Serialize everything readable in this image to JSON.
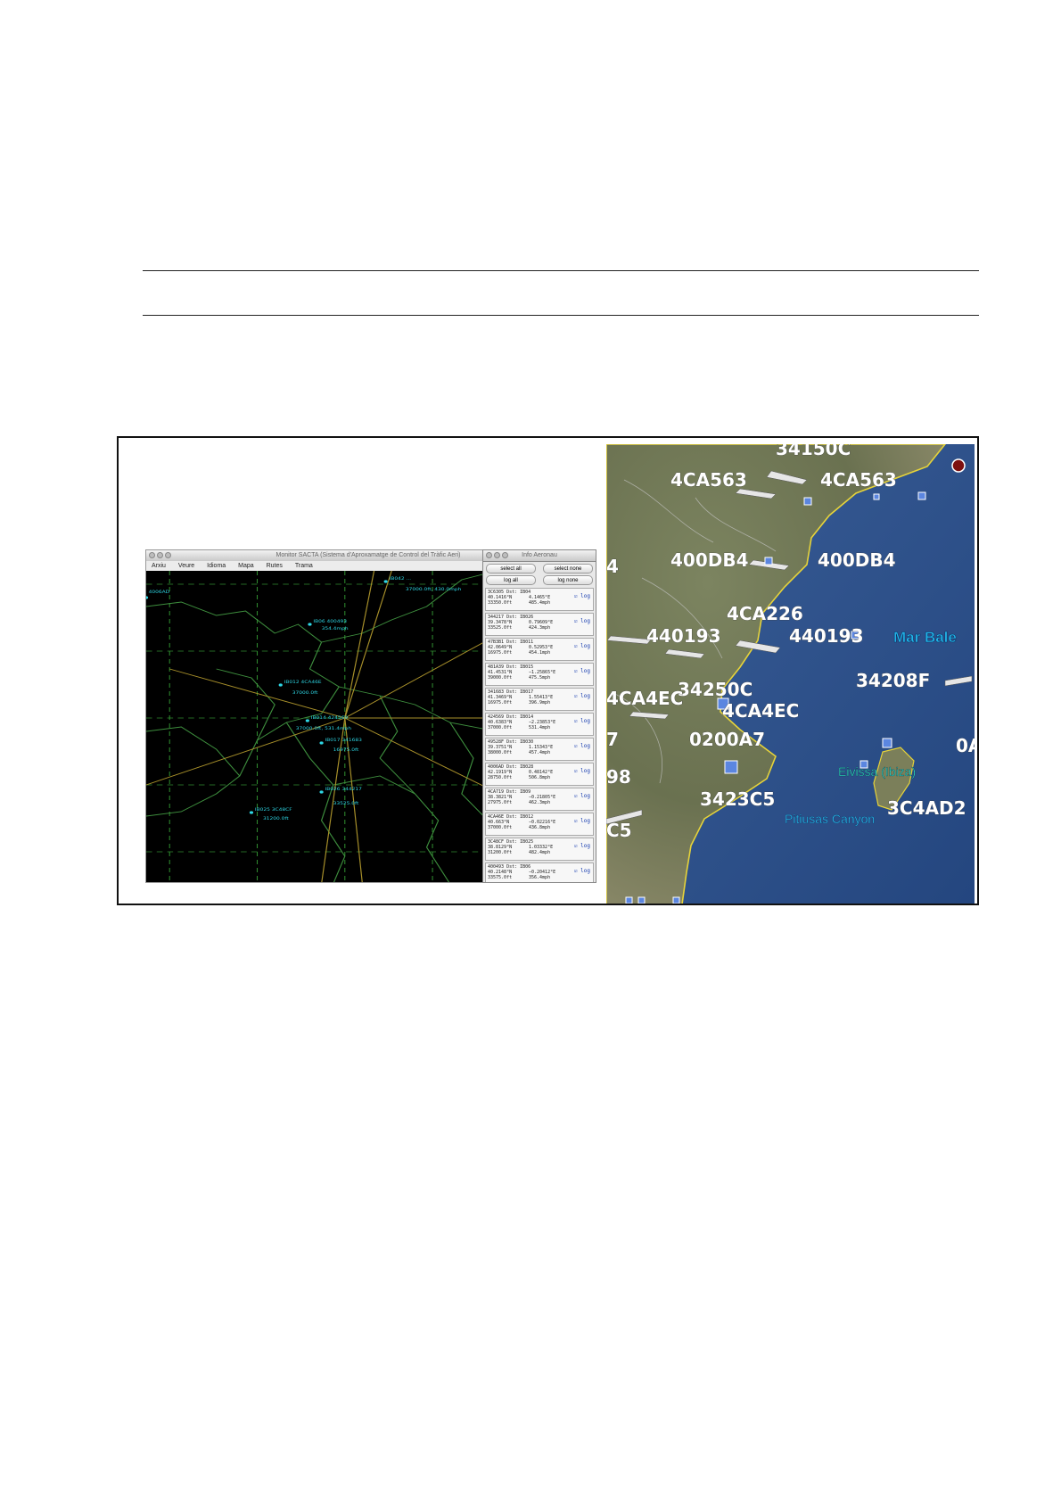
{
  "radar_window": {
    "title": "Monitor SACTA (Sistema d'Aproxamatge de Control del Tràfic Aeri)",
    "menu": [
      "Arxiu",
      "Veure",
      "Idioma",
      "Mapa",
      "Rutes",
      "Trama"
    ]
  },
  "info_window": {
    "title": "Info Aeronau",
    "buttons": {
      "select_all": "select all",
      "select_none": "select none",
      "log_all": "log all",
      "log_none": "log none"
    },
    "log_label": "log",
    "entries": [
      {
        "l1": "3C6305 Dst: IB04",
        "l2a": "40.1416°N",
        "l2b": "4.1465°E",
        "l3a": "33350.0ft",
        "l3b": "485.4mph"
      },
      {
        "l1": "344217 Dst: IB026",
        "l2a": "39.3478°N",
        "l2b": "0.79609°E",
        "l3a": "33525.0ft",
        "l3b": "424.3mph"
      },
      {
        "l1": "47B3B1 Dst: IB011",
        "l2a": "42.0649°N",
        "l2b": "0.52953°E",
        "l3a": "16975.0ft",
        "l3b": "454.1mph"
      },
      {
        "l1": "481A39 Dst: IB015",
        "l2a": "41.4531°N",
        "l2b": "−1.25865°E",
        "l3a": "39000.0ft",
        "l3b": "475.5mph"
      },
      {
        "l1": "341683 Dst: IB017",
        "l2a": "41.3469°N",
        "l2b": "1.55413°E",
        "l3a": "16975.0ft",
        "l3b": "396.9mph"
      },
      {
        "l1": "424569 Dst: IB014",
        "l2a": "40.6383°N",
        "l2b": "−2.23853°E",
        "l3a": "37000.0ft",
        "l3b": "531.4mph"
      },
      {
        "l1": "49528F Dst: IB030",
        "l2a": "39.3751°N",
        "l2b": "1.15343°E",
        "l3a": "38000.0ft",
        "l3b": "457.4mph"
      },
      {
        "l1": "4006AD Dst: IB028",
        "l2a": "42.1919°N",
        "l2b": "0.48142°E",
        "l3a": "28750.0ft",
        "l3b": "506.8mph"
      },
      {
        "l1": "4CA719 Dst: IB09",
        "l2a": "38.3821°N",
        "l2b": "−0.21805°E",
        "l3a": "27975.0ft",
        "l3b": "462.3mph"
      },
      {
        "l1": "4CA46E Dst: IB012",
        "l2a": "40.663°N",
        "l2b": "−0.02216°E",
        "l3a": "37000.0ft",
        "l3b": "436.8mph"
      },
      {
        "l1": "3C48CF Dst: IB025",
        "l2a": "38.8129°N",
        "l2b": "1.03332°E",
        "l3a": "31200.0ft",
        "l3b": "482.4mph"
      },
      {
        "l1": "400493 Dst: IB06",
        "l2a": "40.2148°N",
        "l2b": "−0.20412°E",
        "l3a": "33575.0ft",
        "l3b": "356.4mph"
      }
    ]
  },
  "map": {
    "aircraft_labels": [
      "34150C",
      "4CA563",
      "4CA563",
      "400DB4",
      "400DB4",
      "4CA226",
      "440193",
      "440193",
      "34208F",
      "34250C",
      "4CA4EC",
      "4CA4EC",
      "0200A7",
      "3423C5",
      "3C4AD2",
      "0A",
      "4",
      "C5",
      "98",
      "7"
    ],
    "places": {
      "sea": "Mar Bale",
      "island": "Eivissa (Ibiza)",
      "canyon": "Pitiusas Canyon"
    }
  }
}
